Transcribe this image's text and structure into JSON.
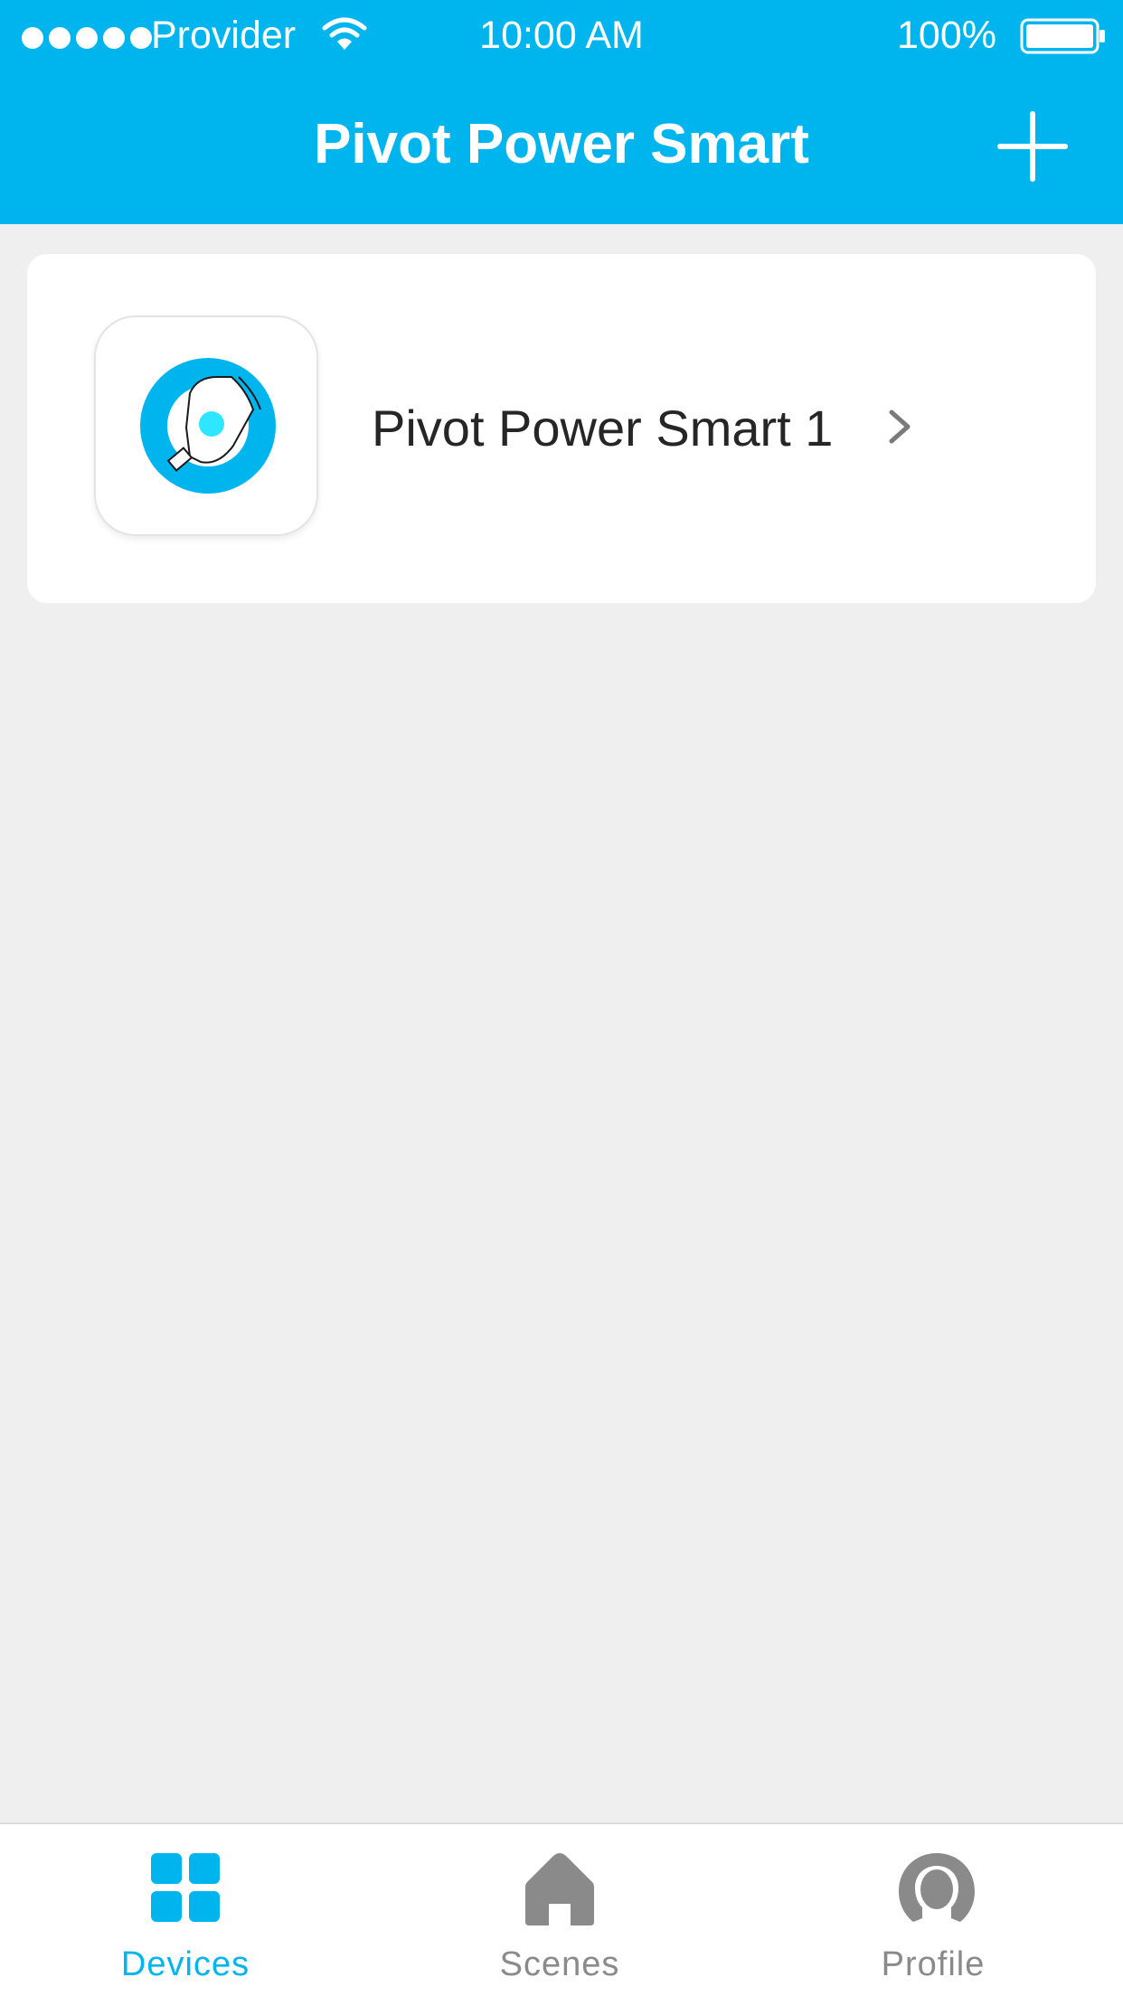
{
  "status_bar": {
    "carrier": "Provider",
    "time": "10:00 AM",
    "battery": "100%"
  },
  "nav": {
    "title": "Pivot Power Smart",
    "add_icon": "plus-icon"
  },
  "devices": [
    {
      "name": "Pivot Power Smart 1",
      "icon": "pivot-power-device-icon"
    }
  ],
  "tabs": [
    {
      "label": "Devices",
      "icon": "grid-icon",
      "active": true
    },
    {
      "label": "Scenes",
      "icon": "home-icon",
      "active": false
    },
    {
      "label": "Profile",
      "icon": "person-icon",
      "active": false
    }
  ],
  "colors": {
    "accent": "#00b5ee",
    "background": "#efeff0",
    "inactive": "#8a8a8a"
  }
}
